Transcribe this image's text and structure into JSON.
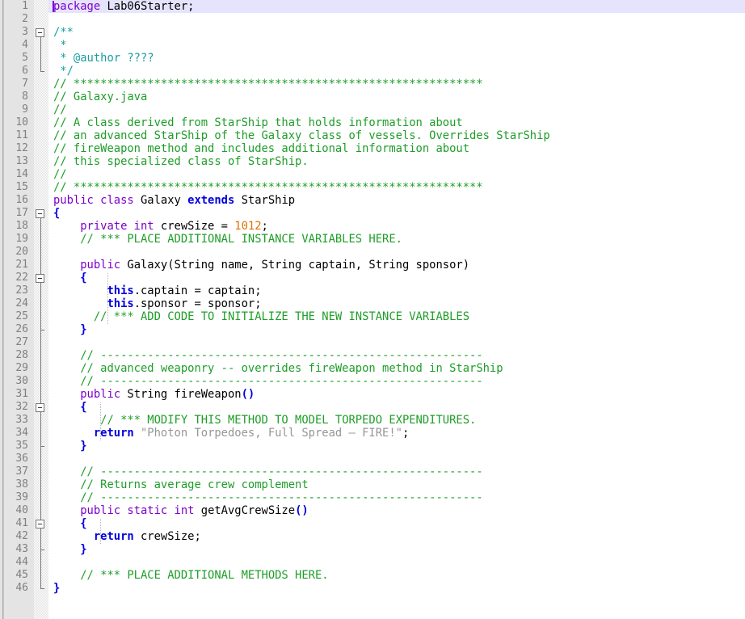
{
  "editor": {
    "language": "java",
    "font": "monospace",
    "line_height_px": 16,
    "first_line": 1,
    "last_line": 46,
    "current_line": 1,
    "caret_line": 1,
    "caret_column": 1,
    "colors": {
      "background": "#ffffff",
      "gutter_background": "#e4e4e4",
      "line_number": "#808080",
      "current_line_highlight": "#e6e4fc",
      "caret": "#7a00cc",
      "keyword_modifier": "#7a00cc",
      "keyword_control": "#0000dd",
      "comment": "#1e9e28",
      "javadoc_comment": "#1a9ea0",
      "string_literal": "#969696",
      "number_literal": "#e07000",
      "identifier": "#000000",
      "fold_marker": "#767676"
    }
  },
  "line_numbers": [
    "1",
    "2",
    "3",
    "4",
    "5",
    "6",
    "7",
    "8",
    "9",
    "10",
    "11",
    "12",
    "13",
    "14",
    "15",
    "16",
    "17",
    "18",
    "19",
    "20",
    "21",
    "22",
    "23",
    "24",
    "25",
    "26",
    "27",
    "28",
    "29",
    "30",
    "31",
    "32",
    "33",
    "34",
    "35",
    "36",
    "37",
    "38",
    "39",
    "40",
    "41",
    "42",
    "43",
    "44",
    "45",
    "46"
  ],
  "fold_markers": [
    {
      "line": 3,
      "type": "open",
      "state": "expanded",
      "glyph": "minus-box"
    },
    {
      "line": 6,
      "type": "close",
      "glyph": "elbow"
    },
    {
      "line": 17,
      "type": "open",
      "state": "expanded",
      "glyph": "minus-box"
    },
    {
      "line": 22,
      "type": "open",
      "state": "expanded",
      "glyph": "minus-box"
    },
    {
      "line": 26,
      "type": "close",
      "glyph": "elbow"
    },
    {
      "line": 32,
      "type": "open",
      "state": "expanded",
      "glyph": "minus-box"
    },
    {
      "line": 35,
      "type": "close",
      "glyph": "elbow"
    },
    {
      "line": 41,
      "type": "open",
      "state": "expanded",
      "glyph": "minus-box"
    },
    {
      "line": 43,
      "type": "close",
      "glyph": "elbow"
    },
    {
      "line": 46,
      "type": "close",
      "glyph": "elbow"
    }
  ],
  "code_lines": [
    {
      "n": 1,
      "text": "package Lab06Starter;",
      "tokens": [
        {
          "t": "package",
          "c": "k-mod"
        },
        {
          "t": " Lab06Starter;",
          "c": "plain"
        }
      ]
    },
    {
      "n": 2,
      "text": "",
      "tokens": []
    },
    {
      "n": 3,
      "text": "/**",
      "tokens": [
        {
          "t": "/**",
          "c": "doc"
        }
      ]
    },
    {
      "n": 4,
      "text": " *",
      "tokens": [
        {
          "t": " *",
          "c": "doc"
        }
      ]
    },
    {
      "n": 5,
      "text": " * @author ????",
      "tokens": [
        {
          "t": " * @author ????",
          "c": "doc"
        }
      ]
    },
    {
      "n": 6,
      "text": " */",
      "tokens": [
        {
          "t": " */",
          "c": "doc"
        }
      ]
    },
    {
      "n": 7,
      "text": "// *************************************************************",
      "tokens": [
        {
          "t": "// *************************************************************",
          "c": "cmt"
        }
      ]
    },
    {
      "n": 8,
      "text": "// Galaxy.java",
      "tokens": [
        {
          "t": "// Galaxy.java",
          "c": "cmt"
        }
      ]
    },
    {
      "n": 9,
      "text": "//",
      "tokens": [
        {
          "t": "//",
          "c": "cmt"
        }
      ]
    },
    {
      "n": 10,
      "text": "// A class derived from StarShip that holds information about",
      "tokens": [
        {
          "t": "// A class derived from StarShip that holds information about",
          "c": "cmt"
        }
      ]
    },
    {
      "n": 11,
      "text": "// an advanced StarShip of the Galaxy class of vessels. Overrides StarShip",
      "tokens": [
        {
          "t": "// an advanced StarShip of the Galaxy class of vessels. Overrides StarShip",
          "c": "cmt"
        }
      ]
    },
    {
      "n": 12,
      "text": "// fireWeapon method and includes additional information about",
      "tokens": [
        {
          "t": "// fireWeapon method and includes additional information about",
          "c": "cmt"
        }
      ]
    },
    {
      "n": 13,
      "text": "// this specialized class of StarShip.",
      "tokens": [
        {
          "t": "// this specialized class of StarShip.",
          "c": "cmt"
        }
      ]
    },
    {
      "n": 14,
      "text": "//",
      "tokens": [
        {
          "t": "//",
          "c": "cmt"
        }
      ]
    },
    {
      "n": 15,
      "text": "// *************************************************************",
      "tokens": [
        {
          "t": "// *************************************************************",
          "c": "cmt"
        }
      ]
    },
    {
      "n": 16,
      "text": "public class Galaxy extends StarShip",
      "tokens": [
        {
          "t": "public class",
          "c": "k-mod"
        },
        {
          "t": " Galaxy ",
          "c": "plain"
        },
        {
          "t": "extends",
          "c": "k-ctl"
        },
        {
          "t": " StarShip",
          "c": "plain"
        }
      ]
    },
    {
      "n": 17,
      "text": "{",
      "tokens": [
        {
          "t": "{",
          "c": "k-ctl"
        }
      ]
    },
    {
      "n": 18,
      "text": "    private int crewSize = 1012;",
      "tokens": [
        {
          "t": "    ",
          "c": "plain"
        },
        {
          "t": "private int",
          "c": "k-mod"
        },
        {
          "t": " crewSize = ",
          "c": "plain"
        },
        {
          "t": "1012",
          "c": "num"
        },
        {
          "t": ";",
          "c": "plain"
        }
      ]
    },
    {
      "n": 19,
      "text": "    // *** PLACE ADDITIONAL INSTANCE VARIABLES HERE.",
      "tokens": [
        {
          "t": "    ",
          "c": "plain"
        },
        {
          "t": "// *** PLACE ADDITIONAL INSTANCE VARIABLES HERE.",
          "c": "cmt"
        }
      ]
    },
    {
      "n": 20,
      "text": "",
      "tokens": []
    },
    {
      "n": 21,
      "text": "    public Galaxy(String name, String captain, String sponsor)",
      "tokens": [
        {
          "t": "    ",
          "c": "plain"
        },
        {
          "t": "public",
          "c": "k-mod"
        },
        {
          "t": " Galaxy(String name, String captain, String sponsor)",
          "c": "plain"
        }
      ]
    },
    {
      "n": 22,
      "text": "    {",
      "tokens": [
        {
          "t": "    ",
          "c": "plain"
        },
        {
          "t": "{",
          "c": "k-ctl"
        }
      ]
    },
    {
      "n": 23,
      "text": "        this.captain = captain;",
      "tokens": [
        {
          "t": "        ",
          "c": "plain"
        },
        {
          "t": "this",
          "c": "k-ctl"
        },
        {
          "t": ".captain = captain;",
          "c": "plain"
        }
      ]
    },
    {
      "n": 24,
      "text": "        this.sponsor = sponsor;",
      "tokens": [
        {
          "t": "        ",
          "c": "plain"
        },
        {
          "t": "this",
          "c": "k-ctl"
        },
        {
          "t": ".sponsor = sponsor;",
          "c": "plain"
        }
      ]
    },
    {
      "n": 25,
      "text": "      // *** ADD CODE TO INITIALIZE THE NEW INSTANCE VARIABLES",
      "tokens": [
        {
          "t": "      ",
          "c": "plain"
        },
        {
          "t": "// *** ADD CODE TO INITIALIZE THE NEW INSTANCE VARIABLES",
          "c": "cmt"
        }
      ]
    },
    {
      "n": 26,
      "text": "    }",
      "tokens": [
        {
          "t": "    ",
          "c": "plain"
        },
        {
          "t": "}",
          "c": "k-ctl"
        }
      ]
    },
    {
      "n": 27,
      "text": "",
      "tokens": []
    },
    {
      "n": 28,
      "text": "    // ---------------------------------------------------------",
      "tokens": [
        {
          "t": "    ",
          "c": "plain"
        },
        {
          "t": "// ---------------------------------------------------------",
          "c": "cmt"
        }
      ]
    },
    {
      "n": 29,
      "text": "    // advanced weaponry -- overrides fireWeapon method in StarShip",
      "tokens": [
        {
          "t": "    ",
          "c": "plain"
        },
        {
          "t": "// advanced weaponry -- overrides fireWeapon method in StarShip",
          "c": "cmt"
        }
      ]
    },
    {
      "n": 30,
      "text": "    // ---------------------------------------------------------",
      "tokens": [
        {
          "t": "    ",
          "c": "plain"
        },
        {
          "t": "// ---------------------------------------------------------",
          "c": "cmt"
        }
      ]
    },
    {
      "n": 31,
      "text": "    public String fireWeapon()",
      "tokens": [
        {
          "t": "    ",
          "c": "plain"
        },
        {
          "t": "public",
          "c": "k-mod"
        },
        {
          "t": " String fireWeapon",
          "c": "plain"
        },
        {
          "t": "()",
          "c": "k-ctl"
        }
      ]
    },
    {
      "n": 32,
      "text": "    {",
      "tokens": [
        {
          "t": "    ",
          "c": "plain"
        },
        {
          "t": "{",
          "c": "k-ctl"
        }
      ]
    },
    {
      "n": 33,
      "text": "       // *** MODIFY THIS METHOD TO MODEL TORPEDO EXPENDITURES.",
      "tokens": [
        {
          "t": "       ",
          "c": "plain"
        },
        {
          "t": "// *** MODIFY THIS METHOD TO MODEL TORPEDO EXPENDITURES.",
          "c": "cmt"
        }
      ]
    },
    {
      "n": 34,
      "text": "      return \"Photon Torpedoes, Full Spread – FIRE!\";",
      "tokens": [
        {
          "t": "      ",
          "c": "plain"
        },
        {
          "t": "return",
          "c": "k-ctl"
        },
        {
          "t": " ",
          "c": "plain"
        },
        {
          "t": "\"Photon Torpedoes, Full Spread – FIRE!\"",
          "c": "str"
        },
        {
          "t": ";",
          "c": "plain"
        }
      ]
    },
    {
      "n": 35,
      "text": "    }",
      "tokens": [
        {
          "t": "    ",
          "c": "plain"
        },
        {
          "t": "}",
          "c": "k-ctl"
        }
      ]
    },
    {
      "n": 36,
      "text": "",
      "tokens": []
    },
    {
      "n": 37,
      "text": "    // ---------------------------------------------------------",
      "tokens": [
        {
          "t": "    ",
          "c": "plain"
        },
        {
          "t": "// ---------------------------------------------------------",
          "c": "cmt"
        }
      ]
    },
    {
      "n": 38,
      "text": "    // Returns average crew complement",
      "tokens": [
        {
          "t": "    ",
          "c": "plain"
        },
        {
          "t": "// Returns average crew complement",
          "c": "cmt"
        }
      ]
    },
    {
      "n": 39,
      "text": "    // ---------------------------------------------------------",
      "tokens": [
        {
          "t": "    ",
          "c": "plain"
        },
        {
          "t": "// ---------------------------------------------------------",
          "c": "cmt"
        }
      ]
    },
    {
      "n": 40,
      "text": "    public static int getAvgCrewSize()",
      "tokens": [
        {
          "t": "    ",
          "c": "plain"
        },
        {
          "t": "public static int",
          "c": "k-mod"
        },
        {
          "t": " getAvgCrewSize",
          "c": "plain"
        },
        {
          "t": "()",
          "c": "k-ctl"
        }
      ]
    },
    {
      "n": 41,
      "text": "    {",
      "tokens": [
        {
          "t": "    ",
          "c": "plain"
        },
        {
          "t": "{",
          "c": "k-ctl"
        }
      ]
    },
    {
      "n": 42,
      "text": "      return crewSize;",
      "tokens": [
        {
          "t": "      ",
          "c": "plain"
        },
        {
          "t": "return",
          "c": "k-ctl"
        },
        {
          "t": " crewSize;",
          "c": "plain"
        }
      ]
    },
    {
      "n": 43,
      "text": "    }",
      "tokens": [
        {
          "t": "    ",
          "c": "plain"
        },
        {
          "t": "}",
          "c": "k-ctl"
        }
      ]
    },
    {
      "n": 44,
      "text": "",
      "tokens": []
    },
    {
      "n": 45,
      "text": "    // *** PLACE ADDITIONAL METHODS HERE.",
      "tokens": [
        {
          "t": "    ",
          "c": "plain"
        },
        {
          "t": "// *** PLACE ADDITIONAL METHODS HERE.",
          "c": "cmt"
        }
      ]
    },
    {
      "n": 46,
      "text": "}",
      "tokens": [
        {
          "t": "}",
          "c": "k-ctl"
        }
      ]
    }
  ],
  "fold_spines": [
    {
      "from_line": 3,
      "to_line": 6
    },
    {
      "from_line": 17,
      "to_line": 46
    },
    {
      "from_line": 22,
      "to_line": 26
    },
    {
      "from_line": 32,
      "to_line": 35
    },
    {
      "from_line": 41,
      "to_line": 43
    }
  ],
  "indent_guides": [
    {
      "from_line": 22,
      "to_line": 25,
      "indent_col": 8
    },
    {
      "from_line": 32,
      "to_line": 34,
      "indent_col": 7
    },
    {
      "from_line": 41,
      "to_line": 42,
      "indent_col": 7
    }
  ]
}
